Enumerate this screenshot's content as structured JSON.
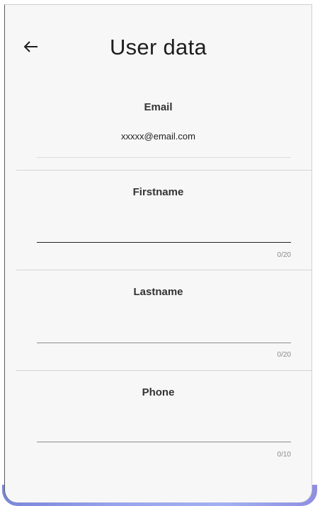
{
  "header": {
    "title": "User data",
    "back_icon": "arrow-left-icon"
  },
  "form": {
    "email": {
      "label": "Email",
      "value": "xxxxx@email.com"
    },
    "firstname": {
      "label": "Firstname",
      "value": "",
      "counter": "0/20"
    },
    "lastname": {
      "label": "Lastname",
      "value": "",
      "counter": "0/20"
    },
    "phone": {
      "label": "Phone",
      "value": "",
      "counter": "0/10"
    }
  },
  "colors": {
    "background": "#f7f7f7",
    "text": "#1e1e1e",
    "divider": "#d4d4d4",
    "active_underline": "#222222",
    "inactive_underline": "#8c8c8c"
  }
}
